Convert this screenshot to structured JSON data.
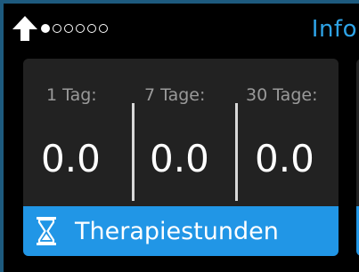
{
  "header": {
    "pager": {
      "count": 6,
      "active_index": 0
    },
    "info_label": "Info"
  },
  "card": {
    "periods": [
      {
        "label": "1 Tag:",
        "value": "0.0"
      },
      {
        "label": "7 Tage:",
        "value": "0.0"
      },
      {
        "label": "30 Tage:",
        "value": "0.0"
      }
    ],
    "footer_label": "Therapiestunden"
  },
  "colors": {
    "accent": "#2196e6",
    "info_text": "#2ea3e6",
    "background": "#000000",
    "card": "#222222",
    "frame": "#1d5a7e"
  }
}
